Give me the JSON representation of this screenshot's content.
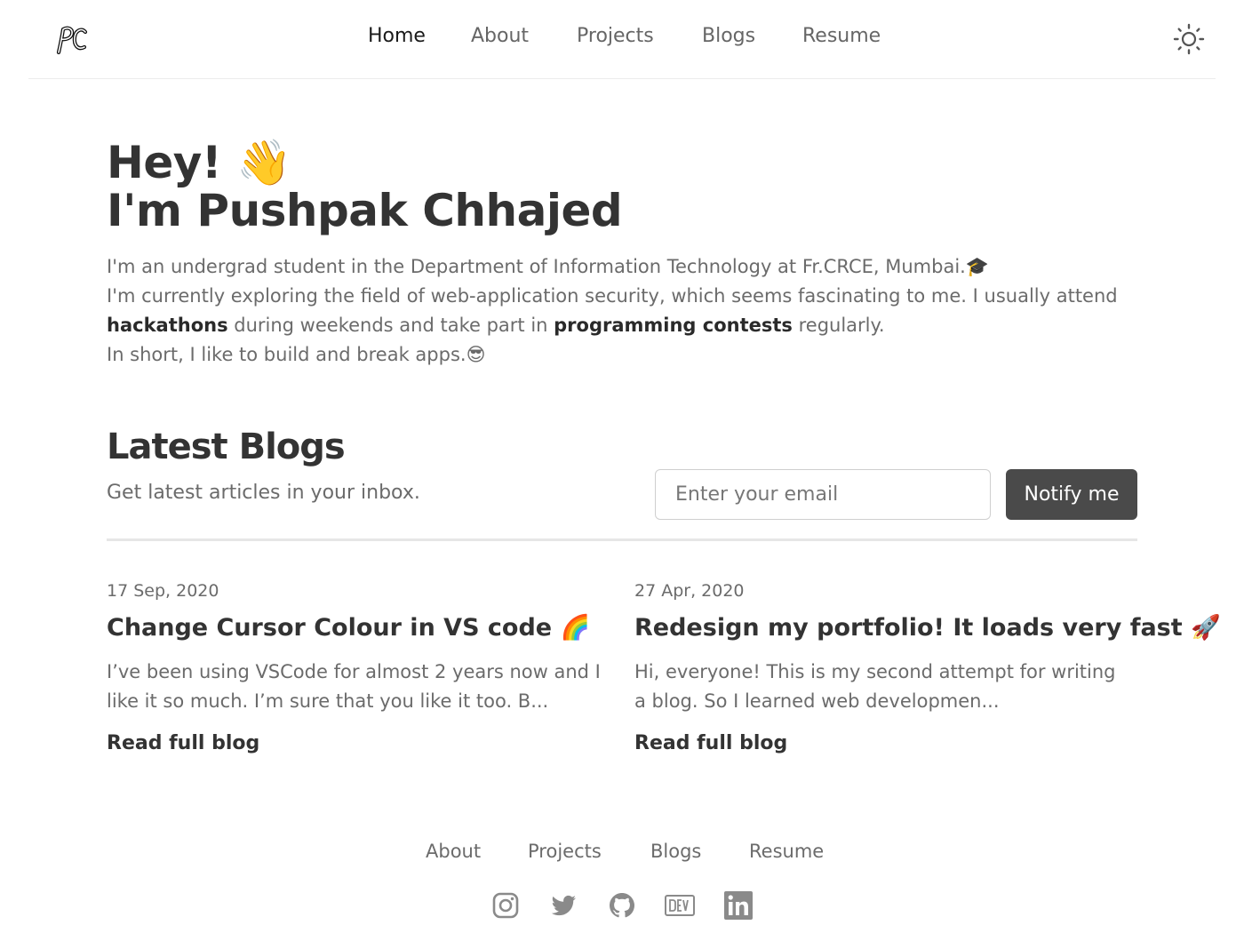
{
  "header": {
    "logo_text": "PC",
    "nav": [
      {
        "label": "Home",
        "active": true
      },
      {
        "label": "About",
        "active": false
      },
      {
        "label": "Projects",
        "active": false
      },
      {
        "label": "Blogs",
        "active": false
      },
      {
        "label": "Resume",
        "active": false
      }
    ],
    "theme_toggle_icon": "sun-icon"
  },
  "hero": {
    "greeting": "Hey! 👋",
    "name_line": "I'm Pushpak Chhajed",
    "line1": "I'm an undergrad student in the Department of Information Technology at Fr.CRCE, Mumbai.🎓",
    "line2": "I'm currently exploring the field of web-application security, which seems fascinating to me. I usually attend",
    "line3_bold1": "hackathons",
    "line3_mid": " during weekends and take part in ",
    "line3_bold2": "programming contests",
    "line3_end": " regularly.",
    "line4": "In short, I like to build and break apps.😎"
  },
  "blogs": {
    "title": "Latest Blogs",
    "subtitle": "Get latest articles in your inbox.",
    "email_placeholder": "Enter your email",
    "notify_label": "Notify me",
    "items": [
      {
        "date": "17 Sep, 2020",
        "title": "Change Cursor Colour in VS code 🌈",
        "excerpt": "I’ve been using VSCode for almost 2 years now and I like it so much. I’m sure that you like it too. B...",
        "link": "Read full blog"
      },
      {
        "date": "27 Apr, 2020",
        "title": "Redesign my portfolio! It loads very fast 🚀",
        "excerpt": "Hi, everyone! This is my second attempt for writing a blog. So I learned web developmen...",
        "link": "Read full blog"
      }
    ]
  },
  "footer": {
    "nav": [
      "About",
      "Projects",
      "Blogs",
      "Resume"
    ],
    "social_icons": [
      "instagram-icon",
      "twitter-icon",
      "github-icon",
      "dev-icon",
      "linkedin-icon"
    ]
  },
  "colors": {
    "text_primary": "#333333",
    "text_secondary": "#6b6b6b",
    "button_bg": "#4a4a4a",
    "icon_gray": "#8a8a8a"
  }
}
